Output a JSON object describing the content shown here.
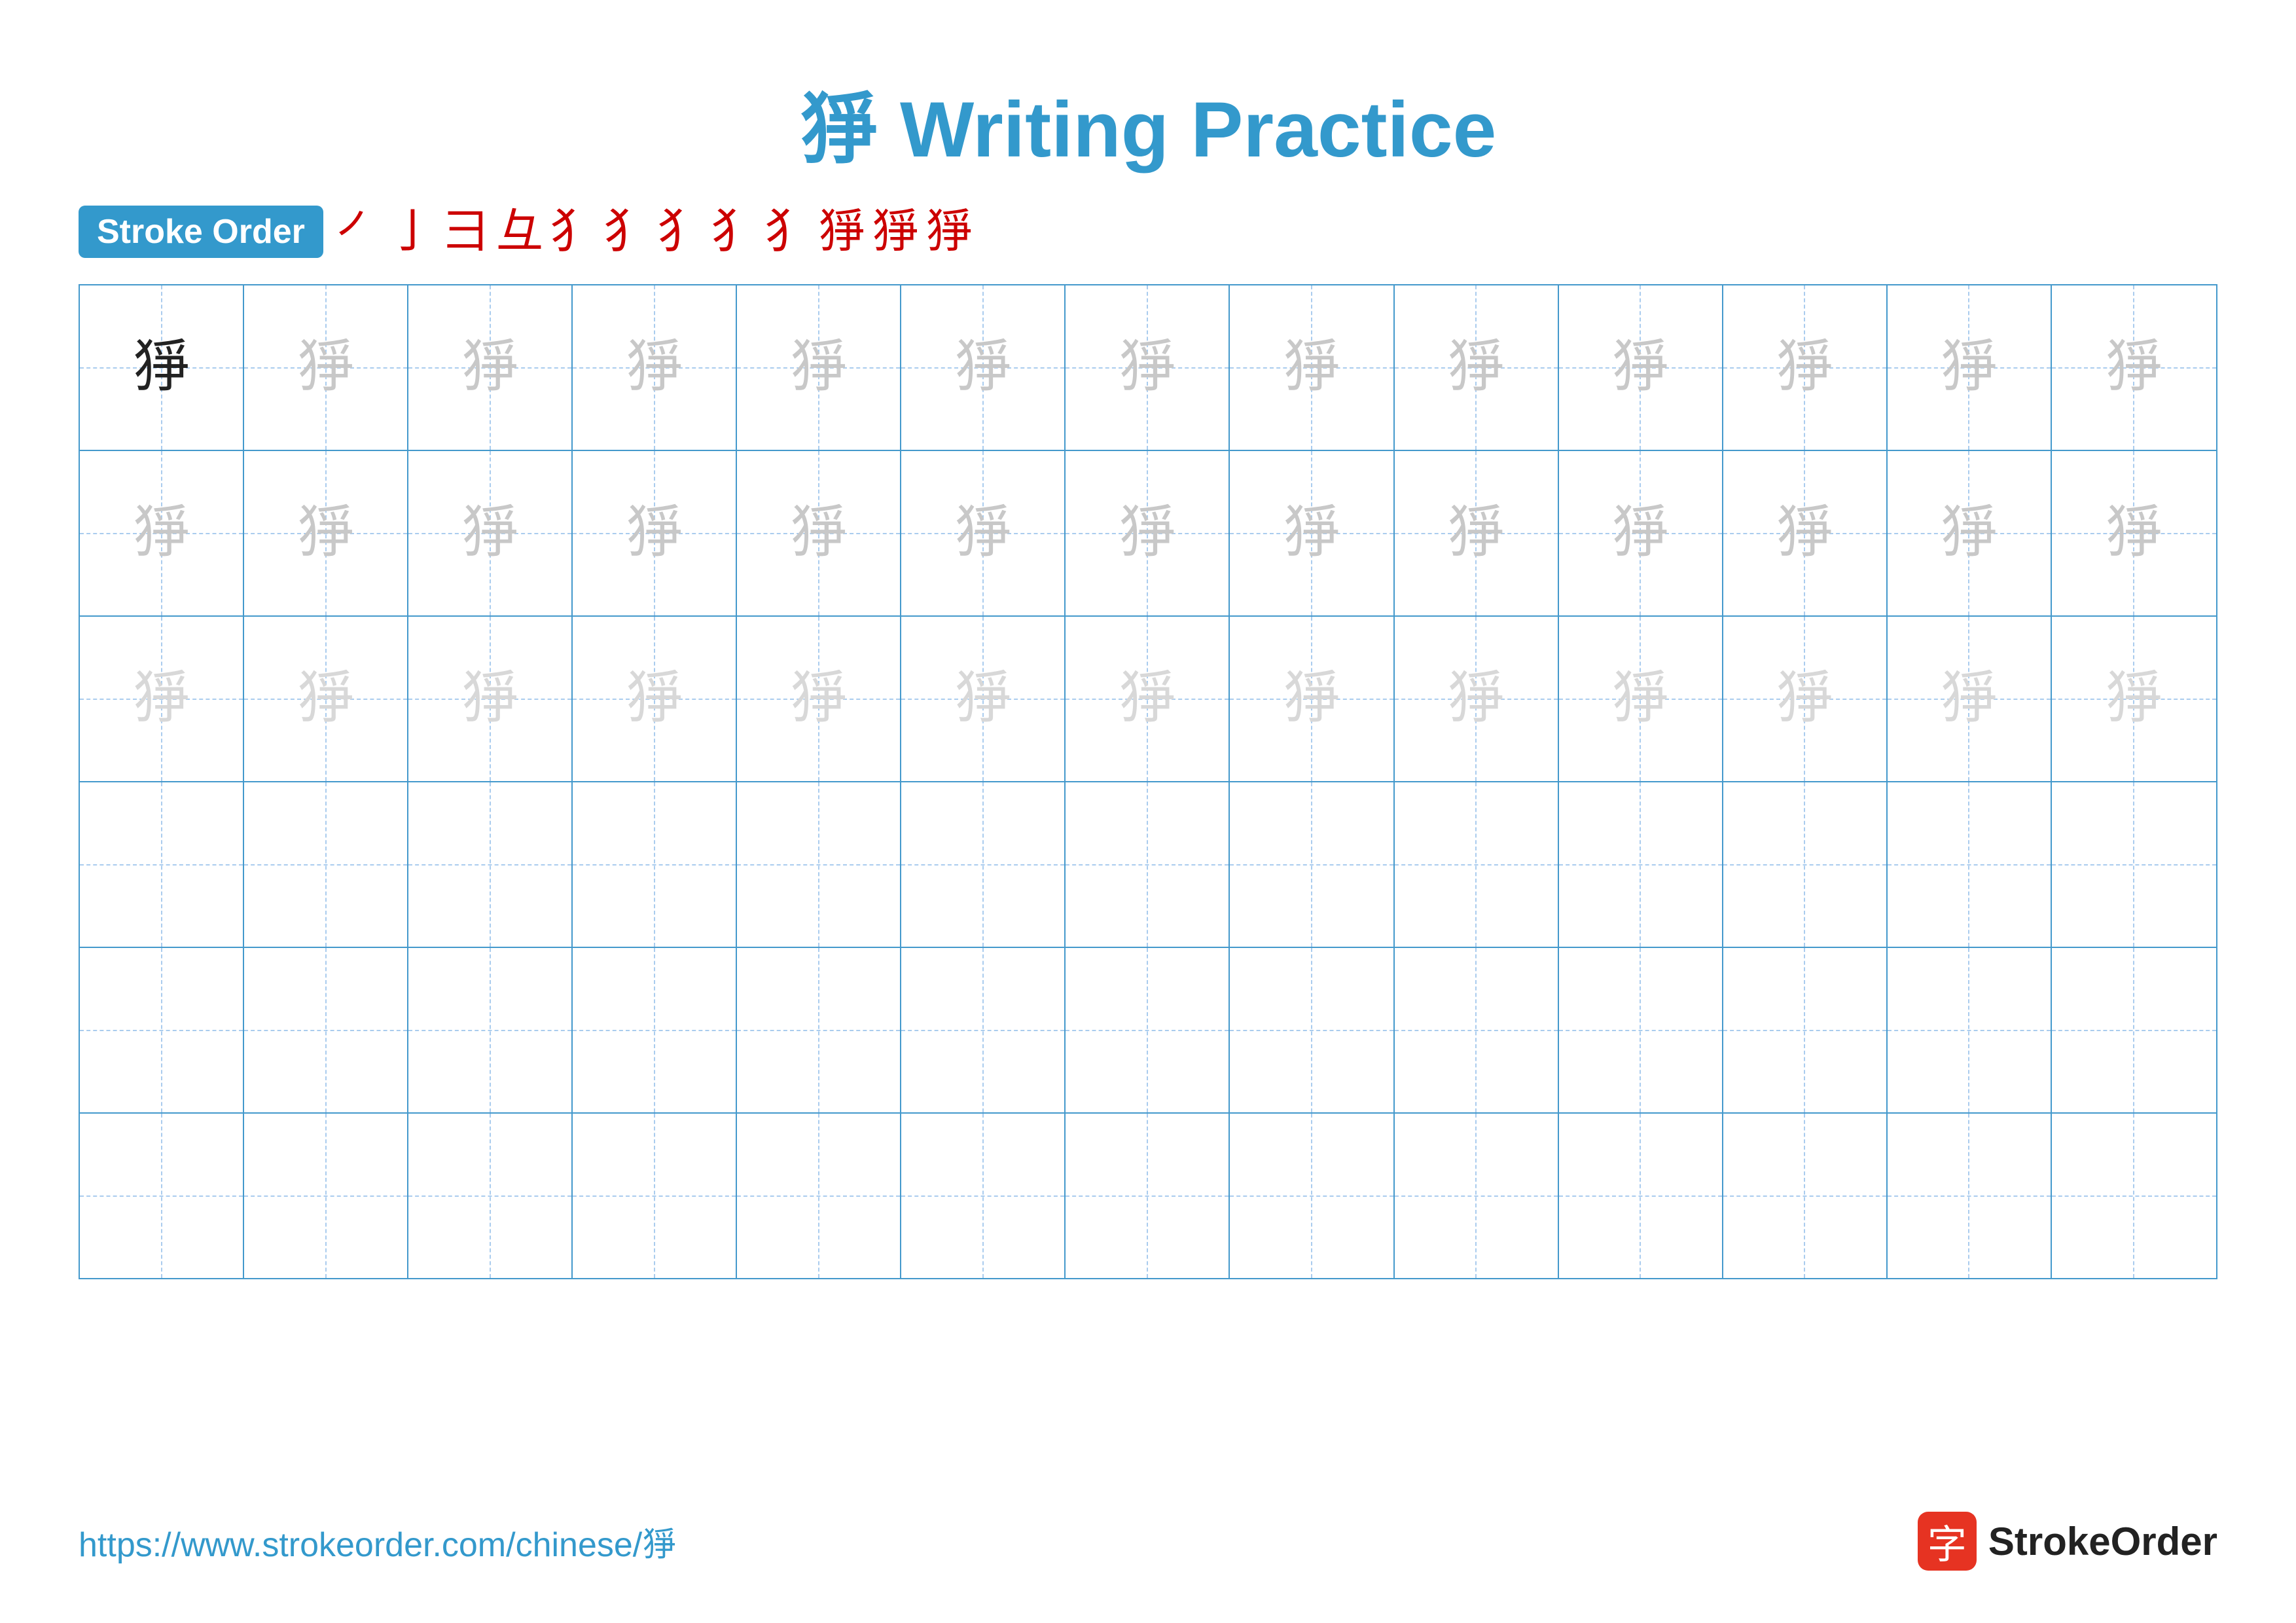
{
  "title": "猙 Writing Practice",
  "stroke_order_label": "Stroke Order",
  "stroke_sequence": [
    "㇒",
    "亅",
    "彐",
    "彑",
    "犭",
    "犭",
    "犭",
    "犭",
    "犭",
    "猙",
    "猙",
    "猙"
  ],
  "character": "猙",
  "rows": [
    {
      "type": "solid_then_light",
      "cells": [
        {
          "char": "猙",
          "style": "solid"
        },
        {
          "char": "猙",
          "style": "light1"
        },
        {
          "char": "猙",
          "style": "light1"
        },
        {
          "char": "猙",
          "style": "light1"
        },
        {
          "char": "猙",
          "style": "light1"
        },
        {
          "char": "猙",
          "style": "light1"
        },
        {
          "char": "猙",
          "style": "light1"
        },
        {
          "char": "猙",
          "style": "light1"
        },
        {
          "char": "猙",
          "style": "light1"
        },
        {
          "char": "猙",
          "style": "light1"
        },
        {
          "char": "猙",
          "style": "light1"
        },
        {
          "char": "猙",
          "style": "light1"
        },
        {
          "char": "猙",
          "style": "light1"
        }
      ]
    },
    {
      "type": "light",
      "cells": [
        {
          "char": "猙",
          "style": "light1"
        },
        {
          "char": "猙",
          "style": "light1"
        },
        {
          "char": "猙",
          "style": "light1"
        },
        {
          "char": "猙",
          "style": "light1"
        },
        {
          "char": "猙",
          "style": "light1"
        },
        {
          "char": "猙",
          "style": "light1"
        },
        {
          "char": "猙",
          "style": "light1"
        },
        {
          "char": "猙",
          "style": "light1"
        },
        {
          "char": "猙",
          "style": "light1"
        },
        {
          "char": "猙",
          "style": "light1"
        },
        {
          "char": "猙",
          "style": "light1"
        },
        {
          "char": "猙",
          "style": "light1"
        },
        {
          "char": "猙",
          "style": "light1"
        }
      ]
    },
    {
      "type": "lighter",
      "cells": [
        {
          "char": "猙",
          "style": "light2"
        },
        {
          "char": "猙",
          "style": "light2"
        },
        {
          "char": "猙",
          "style": "light2"
        },
        {
          "char": "猙",
          "style": "light2"
        },
        {
          "char": "猙",
          "style": "light2"
        },
        {
          "char": "猙",
          "style": "light2"
        },
        {
          "char": "猙",
          "style": "light2"
        },
        {
          "char": "猙",
          "style": "light2"
        },
        {
          "char": "猙",
          "style": "light2"
        },
        {
          "char": "猙",
          "style": "light2"
        },
        {
          "char": "猙",
          "style": "light2"
        },
        {
          "char": "猙",
          "style": "light2"
        },
        {
          "char": "猙",
          "style": "light2"
        }
      ]
    },
    {
      "type": "empty",
      "cells": [
        {
          "char": "",
          "style": "empty"
        },
        {
          "char": "",
          "style": "empty"
        },
        {
          "char": "",
          "style": "empty"
        },
        {
          "char": "",
          "style": "empty"
        },
        {
          "char": "",
          "style": "empty"
        },
        {
          "char": "",
          "style": "empty"
        },
        {
          "char": "",
          "style": "empty"
        },
        {
          "char": "",
          "style": "empty"
        },
        {
          "char": "",
          "style": "empty"
        },
        {
          "char": "",
          "style": "empty"
        },
        {
          "char": "",
          "style": "empty"
        },
        {
          "char": "",
          "style": "empty"
        },
        {
          "char": "",
          "style": "empty"
        }
      ]
    },
    {
      "type": "empty",
      "cells": [
        {
          "char": "",
          "style": "empty"
        },
        {
          "char": "",
          "style": "empty"
        },
        {
          "char": "",
          "style": "empty"
        },
        {
          "char": "",
          "style": "empty"
        },
        {
          "char": "",
          "style": "empty"
        },
        {
          "char": "",
          "style": "empty"
        },
        {
          "char": "",
          "style": "empty"
        },
        {
          "char": "",
          "style": "empty"
        },
        {
          "char": "",
          "style": "empty"
        },
        {
          "char": "",
          "style": "empty"
        },
        {
          "char": "",
          "style": "empty"
        },
        {
          "char": "",
          "style": "empty"
        },
        {
          "char": "",
          "style": "empty"
        }
      ]
    },
    {
      "type": "empty",
      "cells": [
        {
          "char": "",
          "style": "empty"
        },
        {
          "char": "",
          "style": "empty"
        },
        {
          "char": "",
          "style": "empty"
        },
        {
          "char": "",
          "style": "empty"
        },
        {
          "char": "",
          "style": "empty"
        },
        {
          "char": "",
          "style": "empty"
        },
        {
          "char": "",
          "style": "empty"
        },
        {
          "char": "",
          "style": "empty"
        },
        {
          "char": "",
          "style": "empty"
        },
        {
          "char": "",
          "style": "empty"
        },
        {
          "char": "",
          "style": "empty"
        },
        {
          "char": "",
          "style": "empty"
        },
        {
          "char": "",
          "style": "empty"
        }
      ]
    }
  ],
  "footer": {
    "url": "https://www.strokeorder.com/chinese/猙",
    "logo_char": "字",
    "logo_text": "StrokeOrder"
  }
}
